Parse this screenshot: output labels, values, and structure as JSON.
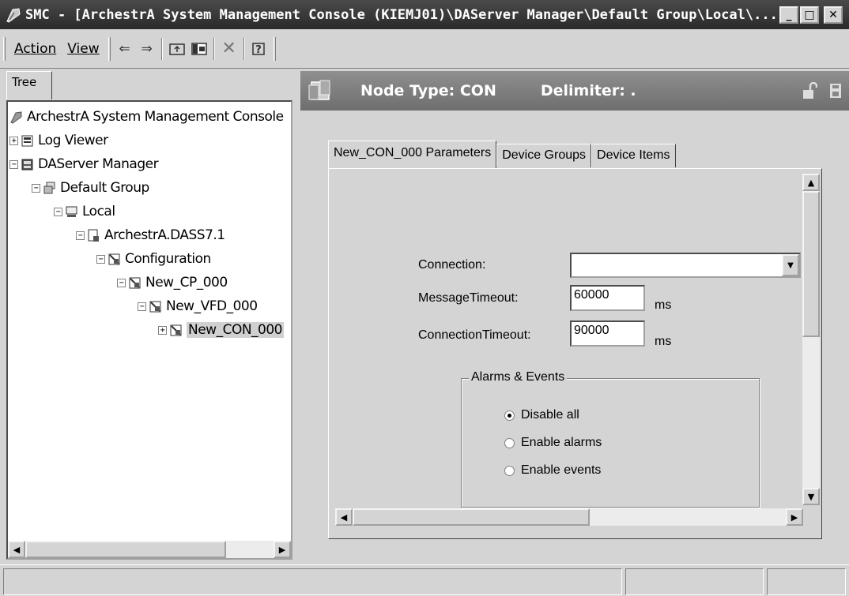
{
  "window": {
    "title": "SMC - [ArchestrA System Management Console (KIEMJ01)\\DAServer Manager\\Default Group\\Local\\..."
  },
  "menu": {
    "action": "Action",
    "view": "View"
  },
  "toolbar_icons": [
    "back-arrow-icon",
    "forward-arrow-icon",
    "up-folder-icon",
    "show-hide-tree-icon",
    "delete-icon",
    "help-icon"
  ],
  "tree": {
    "tab_label": "Tree",
    "root": "ArchestrA System Management Console",
    "items": [
      {
        "label": "Log Viewer",
        "expander": "+"
      },
      {
        "label": "DAServer Manager",
        "expander": "−"
      },
      {
        "label": "Default Group",
        "expander": "−"
      },
      {
        "label": "Local",
        "expander": "−"
      },
      {
        "label": "ArchestrA.DASS7.1",
        "expander": "−"
      },
      {
        "label": "Configuration",
        "expander": "−"
      },
      {
        "label": "New_CP_000",
        "expander": "−"
      },
      {
        "label": "New_VFD_000",
        "expander": "−"
      },
      {
        "label": "New_CON_000",
        "expander": "+",
        "selected": true
      }
    ]
  },
  "header": {
    "node_type": "Node Type: CON",
    "delimiter": "Delimiter: ."
  },
  "tabs": [
    {
      "label": "New_CON_000 Parameters",
      "active": true
    },
    {
      "label": "Device Groups",
      "active": false
    },
    {
      "label": "Device Items",
      "active": false
    }
  ],
  "form": {
    "connection_label": "Connection:",
    "connection_value": "",
    "message_timeout_label": "MessageTimeout:",
    "message_timeout_value": "60000",
    "message_timeout_unit": "ms",
    "connection_timeout_label": "ConnectionTimeout:",
    "connection_timeout_value": "90000",
    "connection_timeout_unit": "ms"
  },
  "alarms_events": {
    "title": "Alarms & Events",
    "options": [
      {
        "label": "Disable all",
        "checked": true
      },
      {
        "label": "Enable alarms",
        "checked": false
      },
      {
        "label": "Enable events",
        "checked": false
      }
    ]
  },
  "colors": {
    "title_bar": "#333333",
    "header_bar": "#7f7f7f",
    "face": "#d4d4d4"
  }
}
